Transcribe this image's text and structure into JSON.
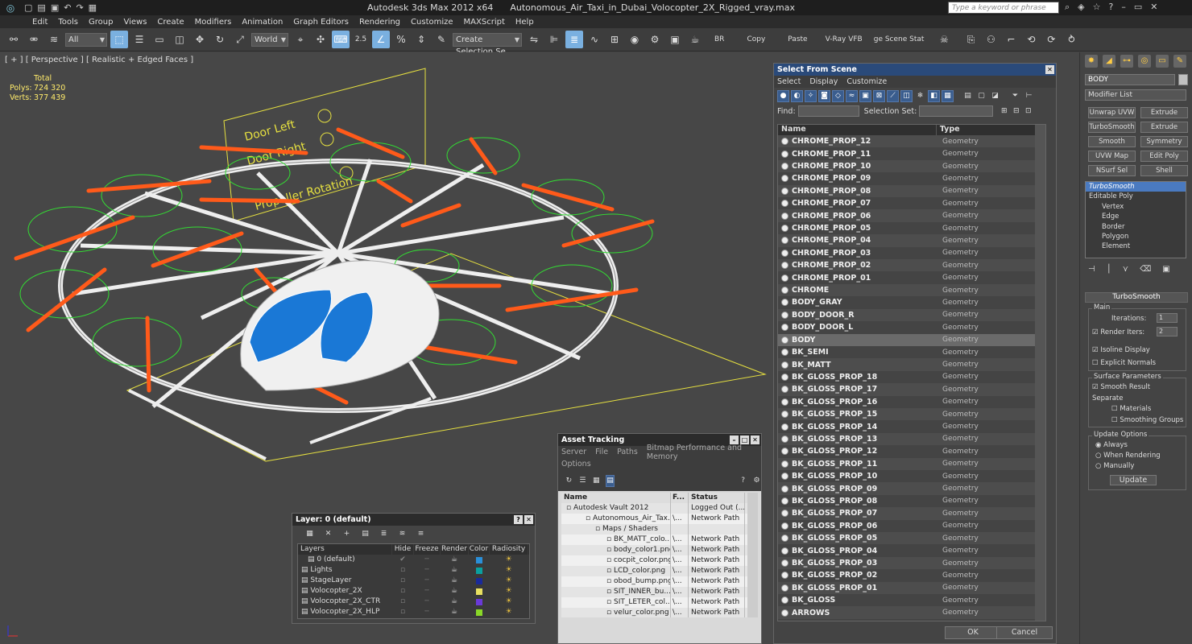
{
  "window": {
    "app_title": "Autodesk 3ds Max  2012 x64",
    "file_title": "Autonomous_Air_Taxi_in_Dubai_Volocopter_2X_Rigged_vray.max",
    "search_placeholder": "Type a keyword or phrase"
  },
  "menu": [
    "Edit",
    "Tools",
    "Group",
    "Views",
    "Create",
    "Modifiers",
    "Animation",
    "Graph Editors",
    "Rendering",
    "Customize",
    "MAXScript",
    "Help"
  ],
  "toolbar": {
    "selection_filter": "All",
    "ref_coord": "World",
    "snap_value": "2.5",
    "named_selection": "Create Selection Se",
    "labels": [
      "BR",
      "Copy",
      "Paste",
      "V-Ray VFB",
      "ge Scene Stat"
    ]
  },
  "viewport": {
    "label": "[ + ] [ Perspective ] [ Realistic + Edged Faces ]",
    "stats": {
      "header": "Total",
      "polys_label": "Polys:",
      "polys": "724 320",
      "verts_label": "Verts:",
      "verts": "377 439"
    },
    "annotations": [
      "Door Left",
      "Door Right",
      "Propeller Rotation"
    ]
  },
  "select_from_scene": {
    "title": "Select From Scene",
    "menu": [
      "Select",
      "Display",
      "Customize"
    ],
    "find_label": "Find:",
    "selection_set_label": "Selection Set:",
    "col_name": "Name",
    "col_type": "Type",
    "rows": [
      {
        "name": "CHROME_PROP_12",
        "type": "Geometry"
      },
      {
        "name": "CHROME_PROP_11",
        "type": "Geometry"
      },
      {
        "name": "CHROME_PROP_10",
        "type": "Geometry"
      },
      {
        "name": "CHROME_PROP_09",
        "type": "Geometry"
      },
      {
        "name": "CHROME_PROP_08",
        "type": "Geometry"
      },
      {
        "name": "CHROME_PROP_07",
        "type": "Geometry"
      },
      {
        "name": "CHROME_PROP_06",
        "type": "Geometry"
      },
      {
        "name": "CHROME_PROP_05",
        "type": "Geometry"
      },
      {
        "name": "CHROME_PROP_04",
        "type": "Geometry"
      },
      {
        "name": "CHROME_PROP_03",
        "type": "Geometry"
      },
      {
        "name": "CHROME_PROP_02",
        "type": "Geometry"
      },
      {
        "name": "CHROME_PROP_01",
        "type": "Geometry"
      },
      {
        "name": "CHROME",
        "type": "Geometry"
      },
      {
        "name": "BODY_GRAY",
        "type": "Geometry"
      },
      {
        "name": "BODY_DOOR_R",
        "type": "Geometry"
      },
      {
        "name": "BODY_DOOR_L",
        "type": "Geometry"
      },
      {
        "name": "BODY",
        "type": "Geometry"
      },
      {
        "name": "BK_SEMI",
        "type": "Geometry"
      },
      {
        "name": "BK_MATT",
        "type": "Geometry"
      },
      {
        "name": "BK_GLOSS_PROP_18",
        "type": "Geometry"
      },
      {
        "name": "BK_GLOSS_PROP_17",
        "type": "Geometry"
      },
      {
        "name": "BK_GLOSS_PROP_16",
        "type": "Geometry"
      },
      {
        "name": "BK_GLOSS_PROP_15",
        "type": "Geometry"
      },
      {
        "name": "BK_GLOSS_PROP_14",
        "type": "Geometry"
      },
      {
        "name": "BK_GLOSS_PROP_13",
        "type": "Geometry"
      },
      {
        "name": "BK_GLOSS_PROP_12",
        "type": "Geometry"
      },
      {
        "name": "BK_GLOSS_PROP_11",
        "type": "Geometry"
      },
      {
        "name": "BK_GLOSS_PROP_10",
        "type": "Geometry"
      },
      {
        "name": "BK_GLOSS_PROP_09",
        "type": "Geometry"
      },
      {
        "name": "BK_GLOSS_PROP_08",
        "type": "Geometry"
      },
      {
        "name": "BK_GLOSS_PROP_07",
        "type": "Geometry"
      },
      {
        "name": "BK_GLOSS_PROP_06",
        "type": "Geometry"
      },
      {
        "name": "BK_GLOSS_PROP_05",
        "type": "Geometry"
      },
      {
        "name": "BK_GLOSS_PROP_04",
        "type": "Geometry"
      },
      {
        "name": "BK_GLOSS_PROP_03",
        "type": "Geometry"
      },
      {
        "name": "BK_GLOSS_PROP_02",
        "type": "Geometry"
      },
      {
        "name": "BK_GLOSS_PROP_01",
        "type": "Geometry"
      },
      {
        "name": "BK_GLOSS",
        "type": "Geometry"
      },
      {
        "name": "ARROWS",
        "type": "Geometry"
      }
    ],
    "selected": "BODY",
    "ok": "OK",
    "cancel": "Cancel"
  },
  "asset_tracking": {
    "title": "Asset Tracking",
    "menu1": [
      "Server",
      "File",
      "Paths",
      "Bitmap Performance and Memory"
    ],
    "menu2": [
      "Options"
    ],
    "cols": [
      "Name",
      "F...",
      "Status"
    ],
    "rows": [
      {
        "name": "Autodesk Vault 2012",
        "f": "",
        "status": "Logged Out (..."
      },
      {
        "name": "Autonomous_Air_Tax...",
        "f": "\\...",
        "status": "Network Path"
      },
      {
        "name": "Maps / Shaders",
        "f": "",
        "status": ""
      },
      {
        "name": "BK_MATT_colo...",
        "f": "\\...",
        "status": "Network Path"
      },
      {
        "name": "body_color1.png",
        "f": "\\...",
        "status": "Network Path"
      },
      {
        "name": "cocpit_color.png",
        "f": "\\...",
        "status": "Network Path"
      },
      {
        "name": "LCD_color.png",
        "f": "\\...",
        "status": "Network Path"
      },
      {
        "name": "obod_bump.png",
        "f": "\\...",
        "status": "Network Path"
      },
      {
        "name": "SIT_INNER_bu...",
        "f": "\\...",
        "status": "Network Path"
      },
      {
        "name": "SIT_LETER_col...",
        "f": "\\...",
        "status": "Network Path"
      },
      {
        "name": "velur_color.png",
        "f": "\\...",
        "status": "Network Path"
      }
    ]
  },
  "layer_panel": {
    "title": "Layer: 0 (default)",
    "cols": [
      "Layers",
      "Hide",
      "Freeze",
      "Render",
      "Color",
      "Radiosity"
    ],
    "rows": [
      {
        "name": "0 (default)",
        "color": "#2a8fd8"
      },
      {
        "name": "Lights",
        "color": "#0aa0a0"
      },
      {
        "name": "StageLayer",
        "color": "#1a2a9a"
      },
      {
        "name": "Volocopter_2X",
        "color": "#e8e060"
      },
      {
        "name": "Volocopter_2X_CTR",
        "color": "#6a3ad8"
      },
      {
        "name": "Volocopter_2X_HLP",
        "color": "#8ad828"
      }
    ]
  },
  "command_panel": {
    "object_name": "BODY",
    "modifier_list": "Modifier List",
    "buttons": [
      "Unwrap UVW",
      "Extrude",
      "TurboSmooth",
      "Extrude",
      "Smooth",
      "Symmetry",
      "UVW Map",
      "Edit Poly",
      "NSurf Sel",
      "Shell"
    ],
    "stack": [
      "TurboSmooth",
      "Editable Poly",
      "Vertex",
      "Edge",
      "Border",
      "Polygon",
      "Element"
    ],
    "rollout": "TurboSmooth",
    "main_label": "Main",
    "iterations_label": "Iterations:",
    "iterations": "1",
    "render_iters_label": "Render Iters:",
    "render_iters": "2",
    "isoline": "Isoline Display",
    "explicit": "Explicit Normals",
    "surface_params": "Surface Parameters",
    "smooth_result": "Smooth Result",
    "separate": "Separate",
    "materials": "Materials",
    "smoothing_groups": "Smoothing Groups",
    "update_options": "Update Options",
    "always": "Always",
    "when_rendering": "When Rendering",
    "manually": "Manually",
    "update": "Update"
  }
}
